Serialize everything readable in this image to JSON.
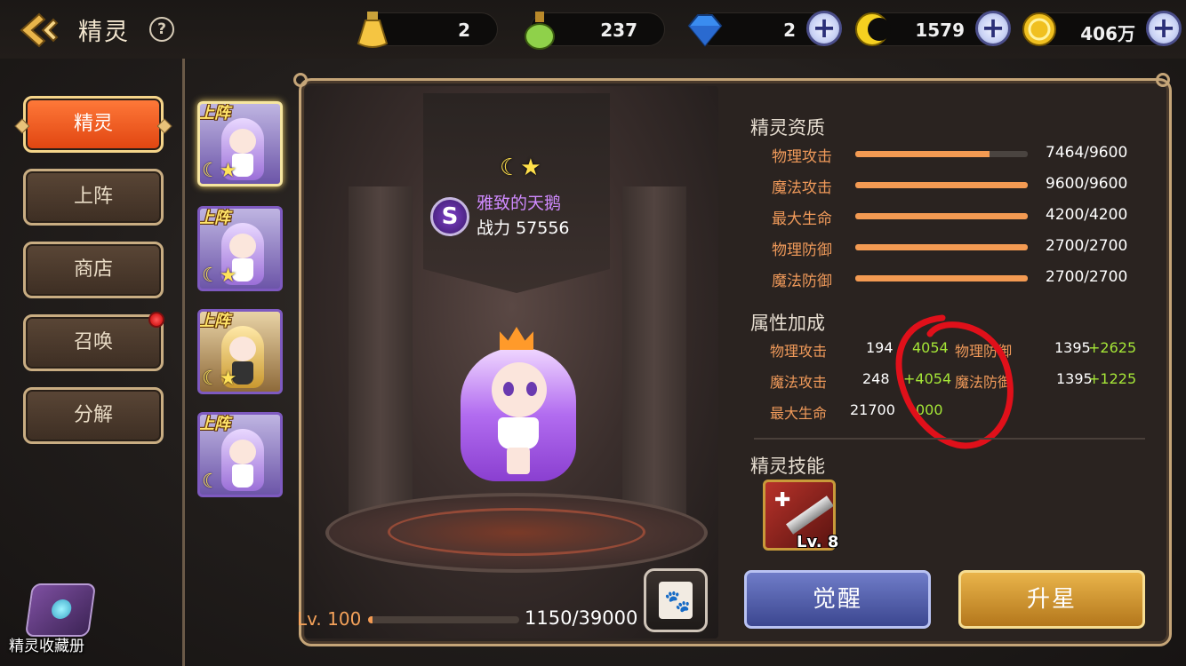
{
  "header": {
    "title": "精灵",
    "help_label": "?",
    "resources": [
      {
        "name": "stamina-potion",
        "value": "2",
        "color": "#f5c542"
      },
      {
        "name": "green-potion",
        "value": "237",
        "color": "#8fd14a"
      },
      {
        "name": "diamond",
        "value": "2",
        "color": "#3a8cf0"
      },
      {
        "name": "crescent-token",
        "value": "1579",
        "color": "#f5d020"
      },
      {
        "name": "gold-coin",
        "value": "406万",
        "color": "#f0c020"
      }
    ],
    "plus_label": "+"
  },
  "nav": {
    "items": [
      {
        "label": "精灵",
        "active": true
      },
      {
        "label": "上阵",
        "active": false
      },
      {
        "label": "商店",
        "active": false
      },
      {
        "label": "召唤",
        "active": false,
        "notification": true
      },
      {
        "label": "分解",
        "active": false
      }
    ],
    "collection_label": "精灵收藏册"
  },
  "cards": [
    {
      "badge": "上阵",
      "stars": "☾★",
      "selected": true
    },
    {
      "badge": "上阵",
      "stars": "☾★",
      "selected": false
    },
    {
      "badge": "上阵",
      "stars": "☾★",
      "selected": false
    },
    {
      "badge": "上阵",
      "stars": "☾",
      "selected": false
    }
  ],
  "spirit": {
    "stars": "☾★",
    "rank": "S",
    "name": "雅致的天鹅",
    "power_label": "战力",
    "power": "57556",
    "level": "Lv. 100",
    "exp": "1150/39000",
    "exp_fraction": 0.0295
  },
  "quality": {
    "title": "精灵资质",
    "stats": [
      {
        "label": "物理攻击",
        "value": "7464/9600",
        "fraction": 0.7775
      },
      {
        "label": "魔法攻击",
        "value": "9600/9600",
        "fraction": 1.0
      },
      {
        "label": "最大生命",
        "value": "4200/4200",
        "fraction": 1.0
      },
      {
        "label": "物理防御",
        "value": "2700/2700",
        "fraction": 1.0
      },
      {
        "label": "魔法防御",
        "value": "2700/2700",
        "fraction": 1.0
      }
    ]
  },
  "bonus": {
    "title": "属性加成",
    "rows": [
      {
        "l_label": "物理攻击",
        "l_base": "194",
        "l_add": "4054",
        "r_label": "物理防御",
        "r_base": "1395",
        "r_add": "+2625"
      },
      {
        "l_label": "魔法攻击",
        "l_base": "248",
        "l_add": "+4054",
        "r_label": "魔法防御",
        "r_base": "1395",
        "r_add": "+1225"
      },
      {
        "l_label": "最大生命",
        "l_base": "21700",
        "l_add": "000",
        "r_label": "",
        "r_base": "",
        "r_add": ""
      }
    ]
  },
  "skills": {
    "title": "精灵技能",
    "items": [
      {
        "level": "Lv. 8"
      }
    ]
  },
  "actions": {
    "awaken": "觉醒",
    "star_up": "升星"
  }
}
